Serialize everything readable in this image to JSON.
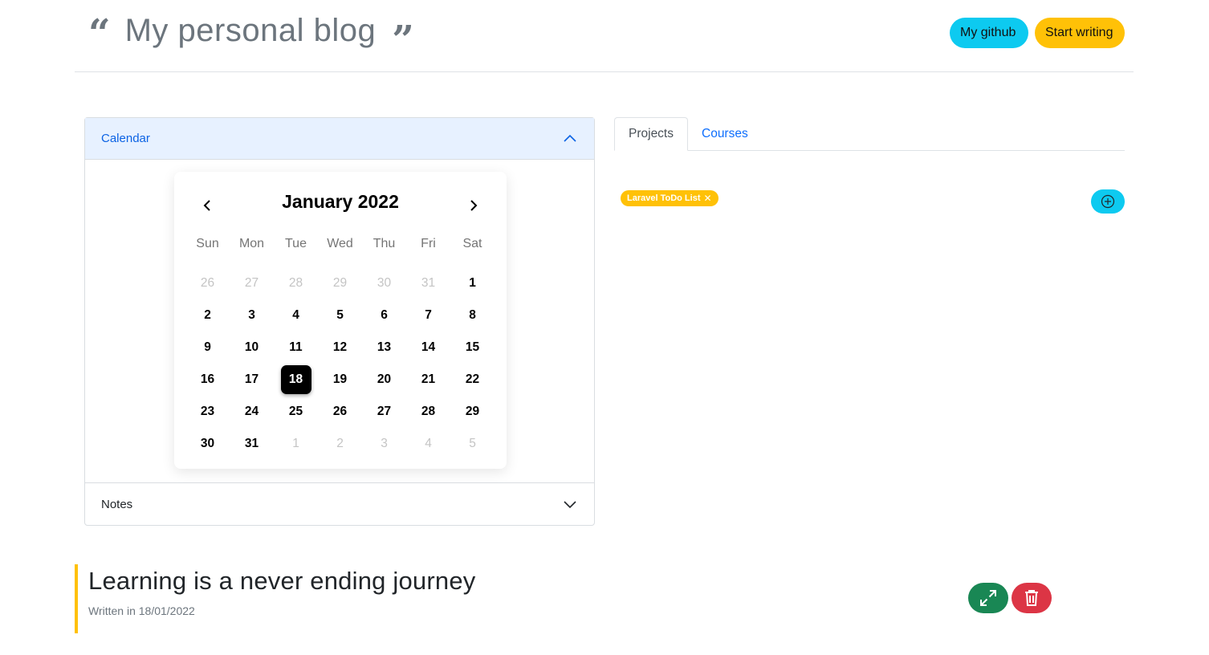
{
  "header": {
    "title": "My personal blog",
    "github_label": "My github",
    "write_label": "Start writing"
  },
  "accordion": {
    "calendar_label": "Calendar",
    "notes_label": "Notes"
  },
  "calendar": {
    "month_label": "January 2022",
    "weekdays": [
      "Sun",
      "Mon",
      "Tue",
      "Wed",
      "Thu",
      "Fri",
      "Sat"
    ],
    "weeks": [
      [
        {
          "d": "26",
          "m": true
        },
        {
          "d": "27",
          "m": true
        },
        {
          "d": "28",
          "m": true
        },
        {
          "d": "29",
          "m": true
        },
        {
          "d": "30",
          "m": true
        },
        {
          "d": "31",
          "m": true
        },
        {
          "d": "1"
        }
      ],
      [
        {
          "d": "2"
        },
        {
          "d": "3"
        },
        {
          "d": "4"
        },
        {
          "d": "5"
        },
        {
          "d": "6"
        },
        {
          "d": "7"
        },
        {
          "d": "8"
        }
      ],
      [
        {
          "d": "9"
        },
        {
          "d": "10"
        },
        {
          "d": "11"
        },
        {
          "d": "12"
        },
        {
          "d": "13"
        },
        {
          "d": "14"
        },
        {
          "d": "15"
        }
      ],
      [
        {
          "d": "16"
        },
        {
          "d": "17"
        },
        {
          "d": "18",
          "s": true
        },
        {
          "d": "19"
        },
        {
          "d": "20"
        },
        {
          "d": "21"
        },
        {
          "d": "22"
        }
      ],
      [
        {
          "d": "23"
        },
        {
          "d": "24"
        },
        {
          "d": "25"
        },
        {
          "d": "26"
        },
        {
          "d": "27"
        },
        {
          "d": "28"
        },
        {
          "d": "29"
        }
      ],
      [
        {
          "d": "30"
        },
        {
          "d": "31"
        },
        {
          "d": "1",
          "m": true
        },
        {
          "d": "2",
          "m": true
        },
        {
          "d": "3",
          "m": true
        },
        {
          "d": "4",
          "m": true
        },
        {
          "d": "5",
          "m": true
        }
      ]
    ]
  },
  "tabs": {
    "items": [
      {
        "label": "Projects",
        "active": true
      },
      {
        "label": "Courses",
        "active": false
      }
    ]
  },
  "projects": {
    "tag_label": "Laravel ToDo List",
    "tag_remove_glyph": "✕"
  },
  "post": {
    "title": "Learning is a never ending journey",
    "meta": "Written in 18/01/2022"
  },
  "colors": {
    "info": "#0dcaf0",
    "warning": "#ffc107",
    "success": "#198754",
    "danger": "#dc3545",
    "accordion_active_bg": "#e7f1ff",
    "link": "#0d6efd"
  },
  "icons": {
    "quote_open": "“",
    "quote_close": "”",
    "add": "plus-circle-icon",
    "expand": "arrows-expand-icon",
    "delete": "trash-icon"
  }
}
